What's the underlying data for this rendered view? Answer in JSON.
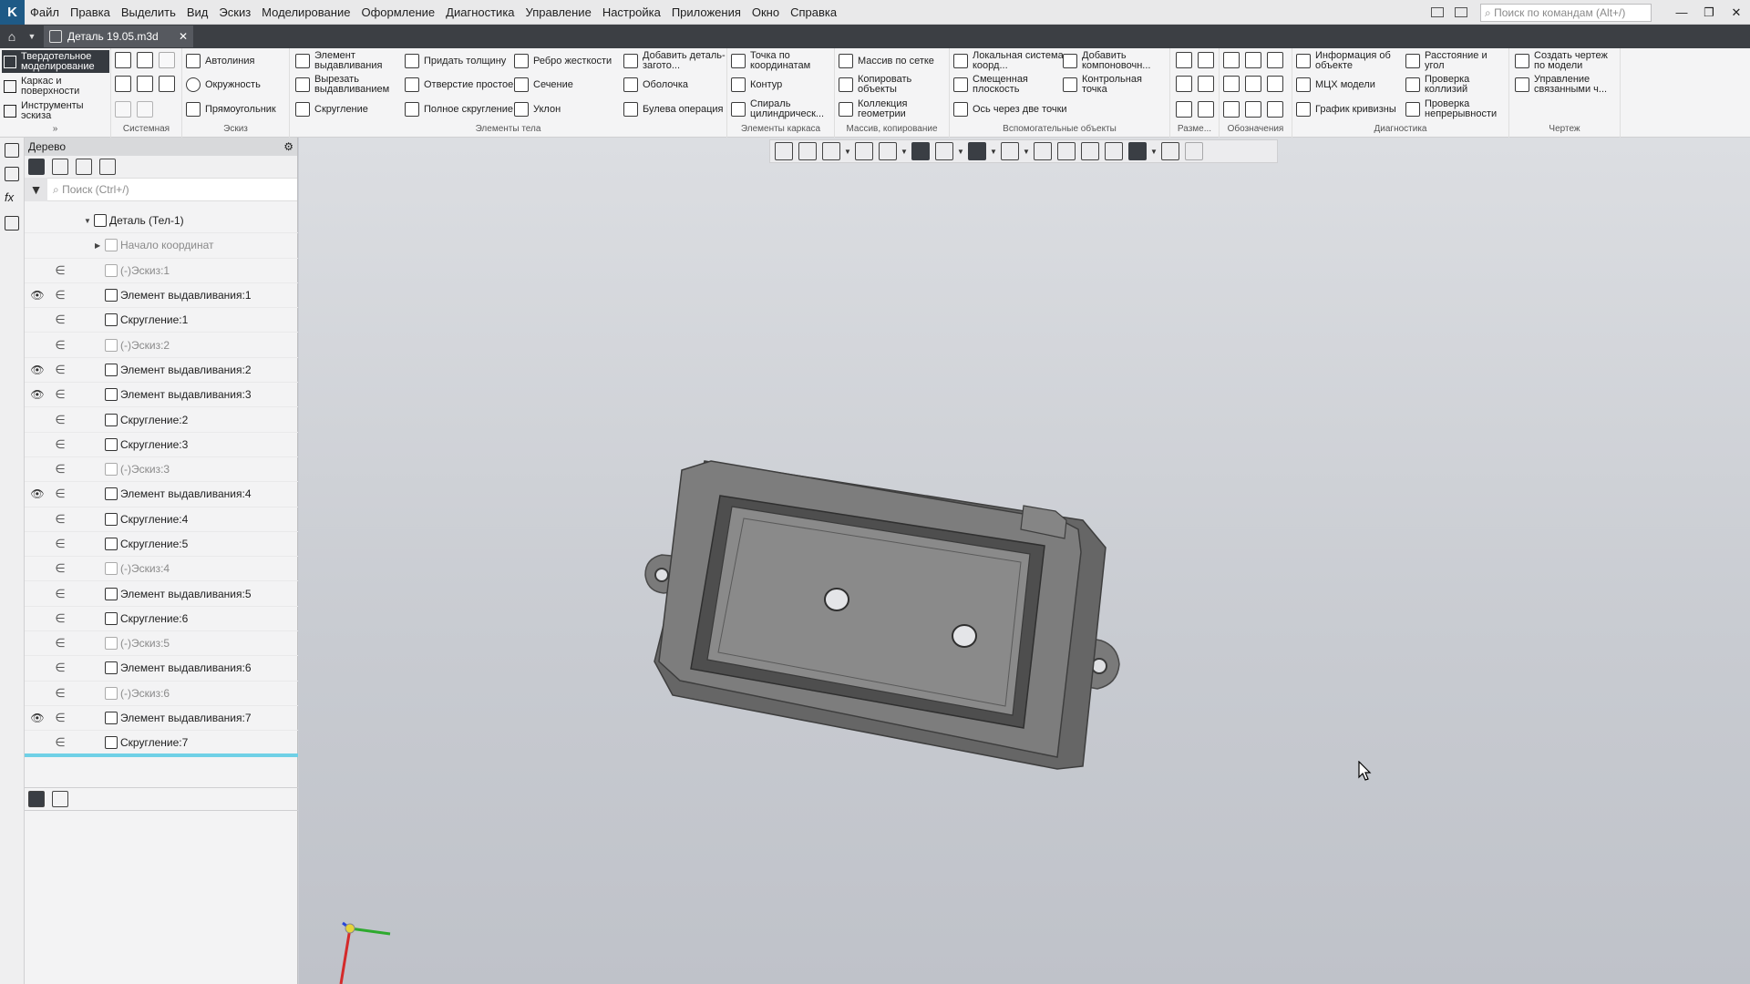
{
  "menubar": {
    "items": [
      "Файл",
      "Правка",
      "Выделить",
      "Вид",
      "Эскиз",
      "Моделирование",
      "Оформление",
      "Диагностика",
      "Управление",
      "Настройка",
      "Приложения",
      "Окно",
      "Справка"
    ],
    "search_placeholder": "Поиск по командам (Alt+/)"
  },
  "tabs": {
    "document": "Деталь 19.05.m3d"
  },
  "ribbon": {
    "modes": [
      "Твердотельное моделирование",
      "Каркас и поверхности",
      "Инструменты эскиза"
    ],
    "sketch": [
      "Автолиния",
      "Окружность",
      "Прямоугольник"
    ],
    "body_col1": [
      "Элемент выдавливания",
      "Вырезать выдавливанием",
      "Скругление"
    ],
    "body_col2": [
      "Придать толщину",
      "Отверстие простое",
      "Полное скругление"
    ],
    "body_col3": [
      "Ребро жесткости",
      "Сечение",
      "Уклон"
    ],
    "body_col4": [
      "Добавить деталь-загото...",
      "Оболочка",
      "Булева операция"
    ],
    "frame": [
      "Точка по координатам",
      "Контур",
      "Спираль цилиндрическ..."
    ],
    "array": [
      "Массив по сетке",
      "Копировать объекты",
      "Коллекция геометрии"
    ],
    "aux_col1": [
      "Локальная система коорд...",
      "Смещенная плоскость",
      "Ось через две точки"
    ],
    "aux_col2": [
      "Добавить компоновочн...",
      "Контрольная точка"
    ],
    "diag_col1": [
      "Информация об объекте",
      "МЦХ модели",
      "График кривизны"
    ],
    "diag_col2": [
      "Расстояние и угол",
      "Проверка коллизий",
      "Проверка непрерывности"
    ],
    "drawing": [
      "Создать чертеж по модели",
      "Управление связанными ч..."
    ],
    "group_titles": {
      "system": "Системная",
      "sketch": "Эскиз",
      "body": "Элементы тела",
      "frame": "Элементы каркаса",
      "array": "Массив, копирование",
      "aux": "Вспомогательные объекты",
      "dims": "Разме...",
      "notes": "Обозначения",
      "diag": "Диагностика",
      "drawing": "Чертеж"
    }
  },
  "tree": {
    "title": "Дерево",
    "search_placeholder": "Поиск (Ctrl+/)",
    "root": "Деталь (Тел-1)",
    "origin": "Начало координат",
    "items": [
      {
        "label": "(-)Эскиз:1",
        "visible": false,
        "dim": true,
        "type": "sketch"
      },
      {
        "label": "Элемент выдавливания:1",
        "visible": true,
        "dim": false,
        "type": "extrude"
      },
      {
        "label": "Скругление:1",
        "visible": false,
        "dim": false,
        "type": "fillet"
      },
      {
        "label": "(-)Эскиз:2",
        "visible": false,
        "dim": true,
        "type": "sketch"
      },
      {
        "label": "Элемент выдавливания:2",
        "visible": true,
        "dim": false,
        "type": "extrude"
      },
      {
        "label": "Элемент выдавливания:3",
        "visible": true,
        "dim": false,
        "type": "extrude"
      },
      {
        "label": "Скругление:2",
        "visible": false,
        "dim": false,
        "type": "fillet"
      },
      {
        "label": "Скругление:3",
        "visible": false,
        "dim": false,
        "type": "fillet"
      },
      {
        "label": "(-)Эскиз:3",
        "visible": false,
        "dim": true,
        "type": "sketch"
      },
      {
        "label": "Элемент выдавливания:4",
        "visible": true,
        "dim": false,
        "type": "extrude"
      },
      {
        "label": "Скругление:4",
        "visible": false,
        "dim": false,
        "type": "fillet"
      },
      {
        "label": "Скругление:5",
        "visible": false,
        "dim": false,
        "type": "fillet"
      },
      {
        "label": "(-)Эскиз:4",
        "visible": false,
        "dim": true,
        "type": "sketch"
      },
      {
        "label": "Элемент выдавливания:5",
        "visible": false,
        "dim": false,
        "type": "extrude"
      },
      {
        "label": "Скругление:6",
        "visible": false,
        "dim": false,
        "type": "fillet"
      },
      {
        "label": "(-)Эскиз:5",
        "visible": false,
        "dim": true,
        "type": "sketch"
      },
      {
        "label": "Элемент выдавливания:6",
        "visible": false,
        "dim": false,
        "type": "extrude"
      },
      {
        "label": "(-)Эскиз:6",
        "visible": false,
        "dim": true,
        "type": "sketch"
      },
      {
        "label": "Элемент выдавливания:7",
        "visible": true,
        "dim": false,
        "type": "extrude"
      },
      {
        "label": "Скругление:7",
        "visible": false,
        "dim": false,
        "type": "fillet"
      }
    ]
  },
  "colors": {
    "accent": "#6fd0e6",
    "dark_tab": "#3c3f44",
    "model_gray": "#7c7c7c"
  }
}
